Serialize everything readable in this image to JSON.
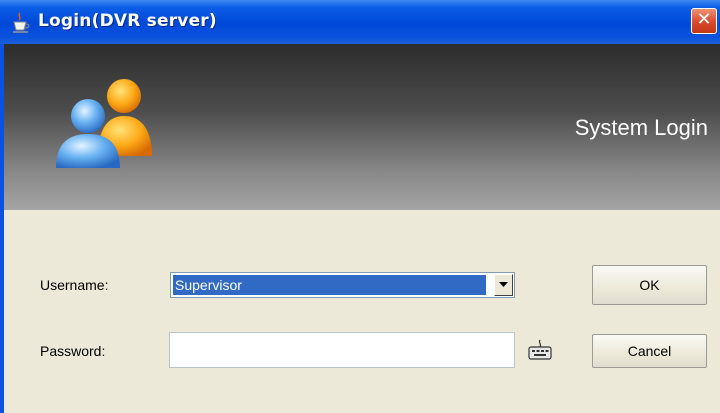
{
  "window": {
    "title": "Login(DVR server)",
    "icons": {
      "title": "java-cup-icon",
      "close": "close-icon"
    },
    "close_glyph": "✕"
  },
  "banner": {
    "title": "System Login",
    "icon": "users-icon"
  },
  "form": {
    "username_label": "Username:",
    "username_value": "Supervisor",
    "password_label": "Password:",
    "password_value": "",
    "keyboard_icon": "keyboard-icon"
  },
  "buttons": {
    "ok": "OK",
    "cancel": "Cancel"
  },
  "colors": {
    "titlebar": "#0b53de",
    "close_button": "#d9482b",
    "selection": "#316ac5",
    "dialog_background": "#ece9d8",
    "banner_dark": "#2d2d2d",
    "banner_light": "#a5a5a5"
  }
}
